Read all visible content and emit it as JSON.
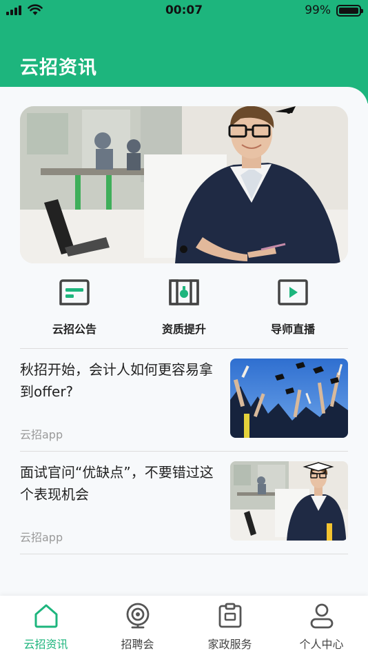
{
  "status_bar": {
    "time": "00:07",
    "battery_percent": "99%",
    "battery_level": 0.99
  },
  "header": {
    "title": "云招资讯"
  },
  "banner": {
    "active_index": 0
  },
  "shortcuts": [
    {
      "label": "云招公告",
      "icon": "notice-icon"
    },
    {
      "label": "资质提升",
      "icon": "book-icon"
    },
    {
      "label": "导师直播",
      "icon": "play-icon"
    }
  ],
  "articles": [
    {
      "title": "秋招开始，会计人如何更容易拿到offer?",
      "source": "云招app",
      "image": "graduation-caps-photo"
    },
    {
      "title": "面试官问“优缺点”，不要错过这个表现机会",
      "source": "云招app",
      "image": "businessman-office-photo"
    }
  ],
  "tabbar": {
    "active": 0,
    "items": [
      {
        "label": "云招资讯",
        "icon": "home-icon"
      },
      {
        "label": "招聘会",
        "icon": "camera-icon"
      },
      {
        "label": "家政服务",
        "icon": "clipboard-icon"
      },
      {
        "label": "个人中心",
        "icon": "user-icon"
      }
    ]
  },
  "colors": {
    "brand": "#1db57d",
    "text": "#222222",
    "muted": "#999999"
  }
}
